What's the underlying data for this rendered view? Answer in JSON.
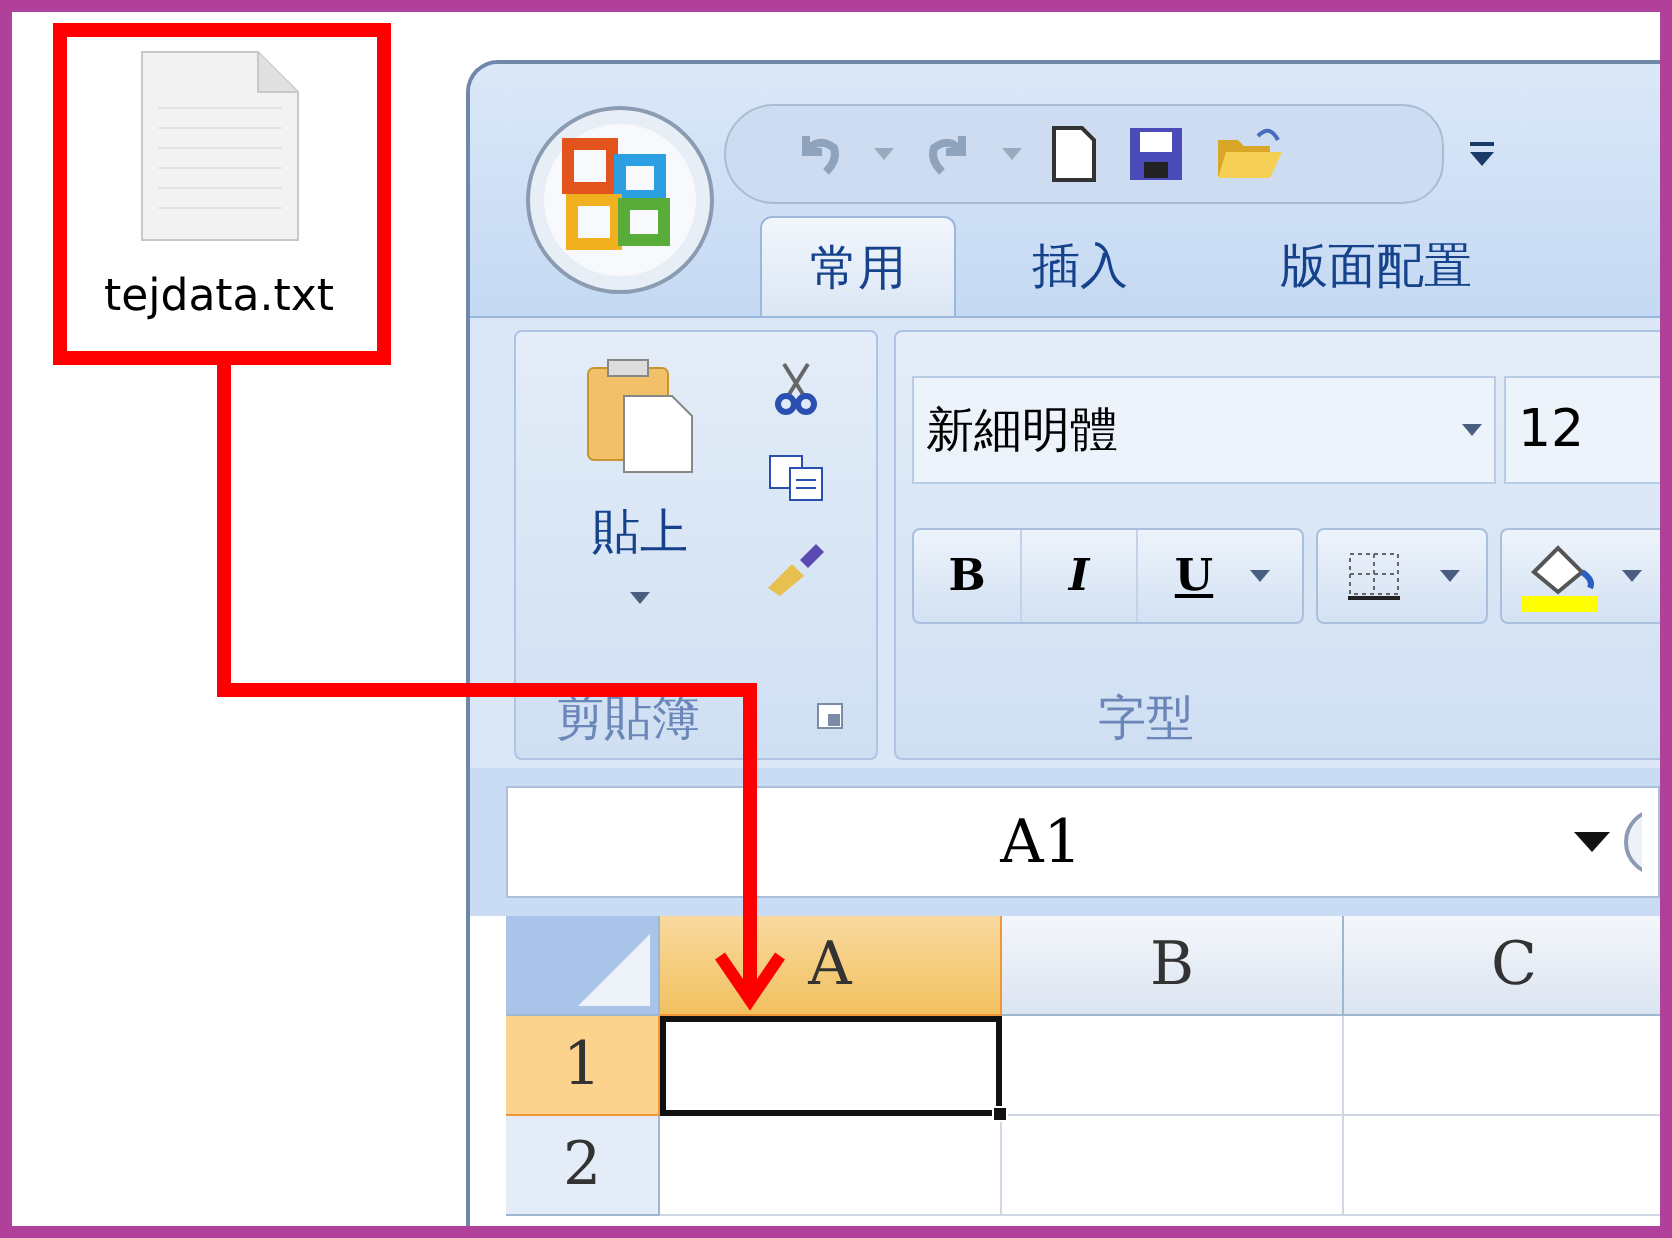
{
  "desktop": {
    "files": [
      {
        "name": "tejdata.txt"
      }
    ]
  },
  "excel": {
    "tabs": [
      {
        "label": "常用",
        "selected": true
      },
      {
        "label": "插入",
        "selected": false
      },
      {
        "label": "版面配置",
        "selected": false
      }
    ],
    "clipboard_group": {
      "paste_label": "貼上",
      "title": "剪貼簿"
    },
    "font_group": {
      "font_name": "新細明體",
      "font_size": "12",
      "bold": "B",
      "italic": "I",
      "underline": "U",
      "title": "字型"
    },
    "name_box": {
      "value": "A1"
    },
    "grid": {
      "columns": [
        {
          "label": "A",
          "selected": true
        },
        {
          "label": "B",
          "selected": false
        },
        {
          "label": "C",
          "selected": false
        }
      ],
      "rows": [
        {
          "label": "1",
          "selected": true
        },
        {
          "label": "2",
          "selected": false
        }
      ]
    }
  }
}
